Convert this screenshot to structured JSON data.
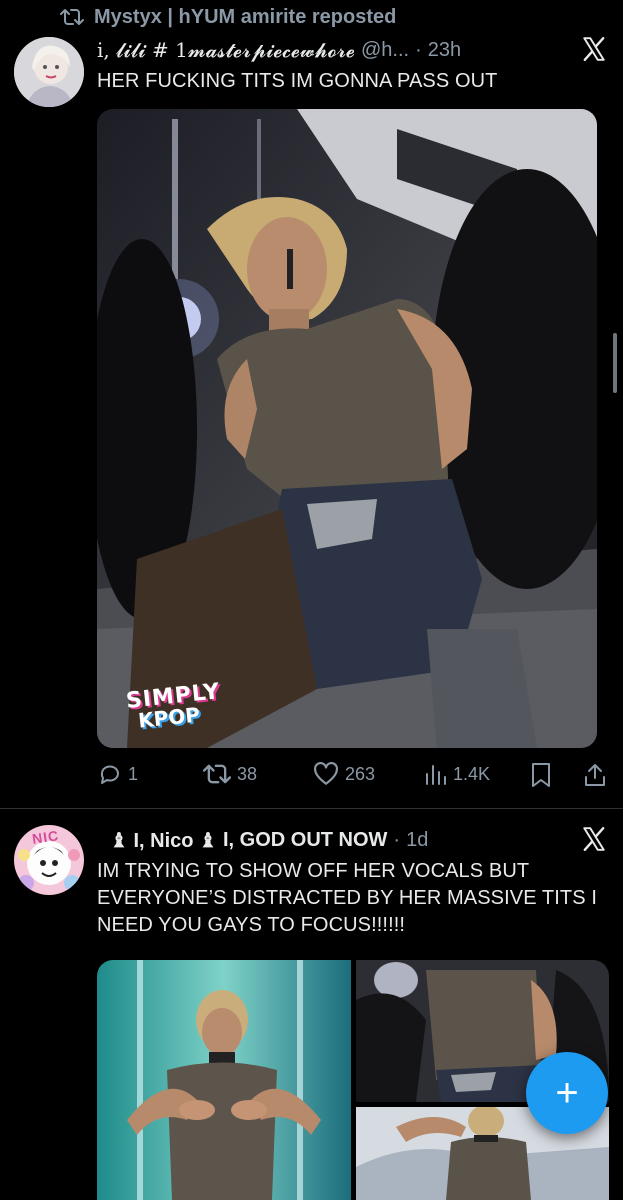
{
  "repost": {
    "text": "Mystyx | hYUM amirite reposted"
  },
  "tweet1": {
    "display_name": "i, 𝓵𝓲𝓵𝓲 # 1𝓶𝓪𝓼𝓽𝓮𝓻𝓹𝓲𝓮𝓬𝓮𝔀𝓱𝓸𝓻𝓮",
    "handle": "@h...",
    "separator": "·",
    "time": "23h",
    "text": "HER FUCKING TITS IM GONNA PASS OUT",
    "watermark_line1": "SIMPLY",
    "watermark_line2": "KPOP",
    "replies": "1",
    "reposts": "38",
    "likes": "263",
    "views": "1.4K"
  },
  "tweet2": {
    "display_name_part1": "♝ I, Nico ♝",
    "display_name_part2": "I, GOD OUT NOW",
    "separator": "·",
    "time": "1d",
    "avatar_text": "NIC",
    "text": "IM TRYING TO SHOW OFF HER VOCALS BUT EVERYONE’S DISTRACTED BY HER MASSIVE TITS I NEED YOU GAYS TO FOCUS!!!!!!"
  },
  "fab": {
    "icon": "plus-icon",
    "glyph": "+"
  },
  "colors": {
    "accent": "#1d9bf0",
    "muted": "#8b98a5",
    "text": "#e7e9ea",
    "bg": "#000000"
  }
}
